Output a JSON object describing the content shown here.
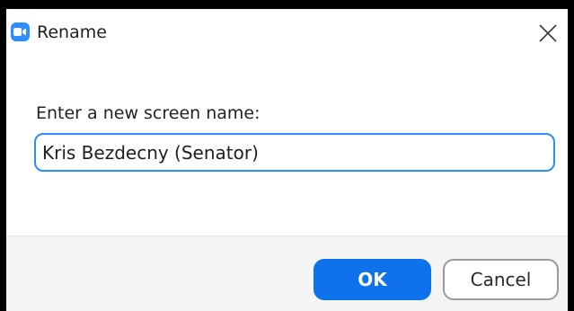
{
  "window": {
    "title": "Rename",
    "app_icon": "zoom-camera-icon",
    "close_icon": "close-icon"
  },
  "form": {
    "prompt": "Enter a new screen name:",
    "screen_name_value": "Kris Bezdecny (Senator)"
  },
  "buttons": {
    "ok_label": "OK",
    "cancel_label": "Cancel"
  },
  "colors": {
    "accent": "#0e72ed",
    "app_icon": "#2d8cff",
    "input_focus_border": "#2d8cff",
    "footer_background": "#f4f4f4"
  }
}
